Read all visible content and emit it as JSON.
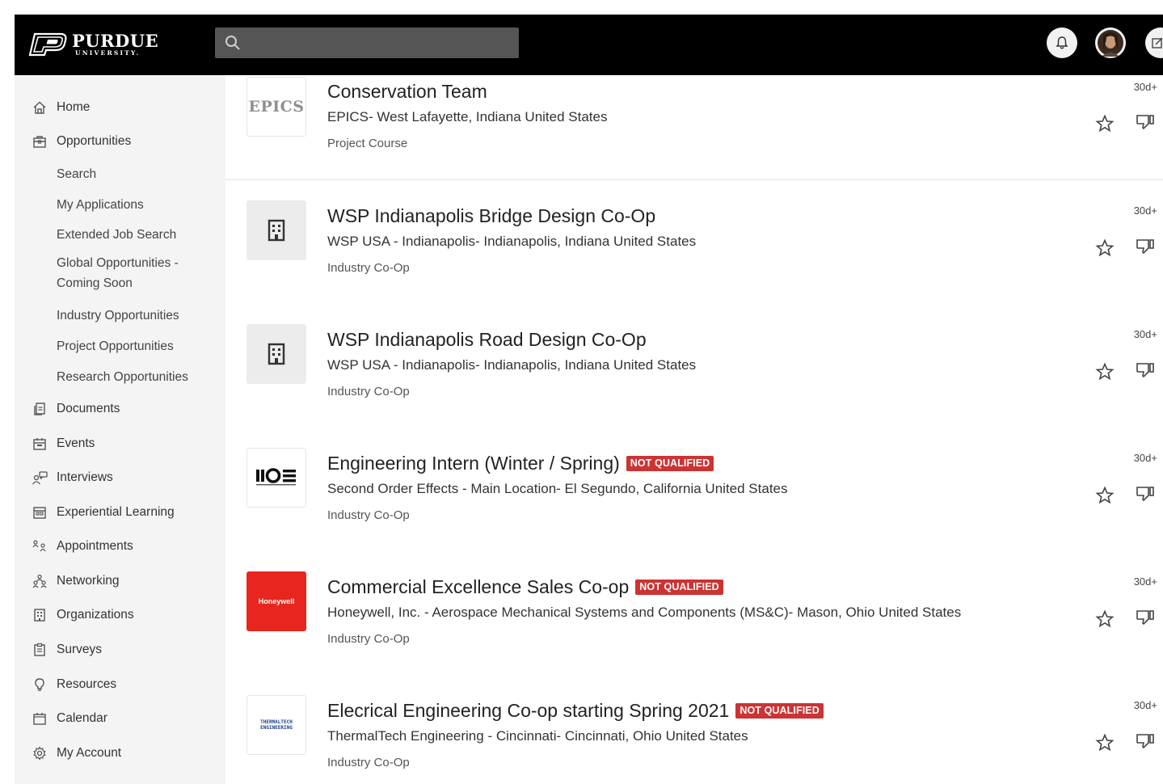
{
  "brand": {
    "name": "PURDUE",
    "sub": "UNIVERSITY."
  },
  "search": {
    "placeholder": "",
    "value": ""
  },
  "sidebar": {
    "items": [
      {
        "label": "Home",
        "icon": "home-icon"
      },
      {
        "label": "Opportunities",
        "icon": "briefcase-icon"
      },
      {
        "label": "Search"
      },
      {
        "label": "My Applications"
      },
      {
        "label": "Extended Job Search"
      },
      {
        "label": "Global Opportunities - Coming Soon"
      },
      {
        "label": "Industry Opportunities"
      },
      {
        "label": "Project Opportunities"
      },
      {
        "label": "Research Opportunities"
      },
      {
        "label": "Documents",
        "icon": "documents-icon"
      },
      {
        "label": "Events",
        "icon": "events-icon"
      },
      {
        "label": "Interviews",
        "icon": "interviews-icon"
      },
      {
        "label": "Experiential Learning",
        "icon": "experiential-learning-icon"
      },
      {
        "label": "Appointments",
        "icon": "appointments-icon"
      },
      {
        "label": "Networking",
        "icon": "networking-icon"
      },
      {
        "label": "Organizations",
        "icon": "organizations-icon"
      },
      {
        "label": "Surveys",
        "icon": "surveys-icon"
      },
      {
        "label": "Resources",
        "icon": "resources-icon"
      },
      {
        "label": "Calendar",
        "icon": "calendar-icon"
      },
      {
        "label": "My Account",
        "icon": "gear-icon"
      }
    ]
  },
  "jobs": [
    {
      "title": "Conservation Team",
      "employer": "EPICS- West Lafayette, Indiana United States",
      "type": "Project Course",
      "age": "30d+",
      "badge": "",
      "logo": "EPICS"
    },
    {
      "title": "WSP Indianapolis Bridge Design Co-Op",
      "employer": "WSP USA - Indianapolis- Indianapolis, Indiana United States",
      "type": "Industry Co-Op",
      "age": "30d+",
      "badge": "",
      "logo": "building-icon"
    },
    {
      "title": "WSP Indianapolis Road Design Co-Op",
      "employer": "WSP USA - Indianapolis- Indianapolis, Indiana United States",
      "type": "Industry Co-Op",
      "age": "30d+",
      "badge": "",
      "logo": "building-icon"
    },
    {
      "title": "Engineering Intern (Winter / Spring)",
      "employer": "Second Order Effects - Main Location- El Segundo, California United States",
      "type": "Industry Co-Op",
      "age": "30d+",
      "badge": "NOT QUALIFIED",
      "logo": "IIOE"
    },
    {
      "title": "Commercial Excellence Sales Co-op",
      "employer": "Honeywell, Inc. - Aerospace Mechanical Systems and Components (MS&C)- Mason, Ohio United States",
      "type": "Industry Co-Op",
      "age": "30d+",
      "badge": "NOT QUALIFIED",
      "logo": "Honeywell"
    },
    {
      "title": "Elecrical Engineering Co-op starting Spring 2021",
      "employer": "ThermalTech Engineering - Cincinnati- Cincinnati, Ohio United States",
      "type": "Industry Co-Op",
      "age": "30d+",
      "badge": "NOT QUALIFIED",
      "logo": "THERMALTECH ENGINEERING"
    }
  ],
  "colors": {
    "topbar": "#000000",
    "badge": "#cc3333",
    "sidebar": "#f4f4f4",
    "honeywell": "#e6261f"
  }
}
